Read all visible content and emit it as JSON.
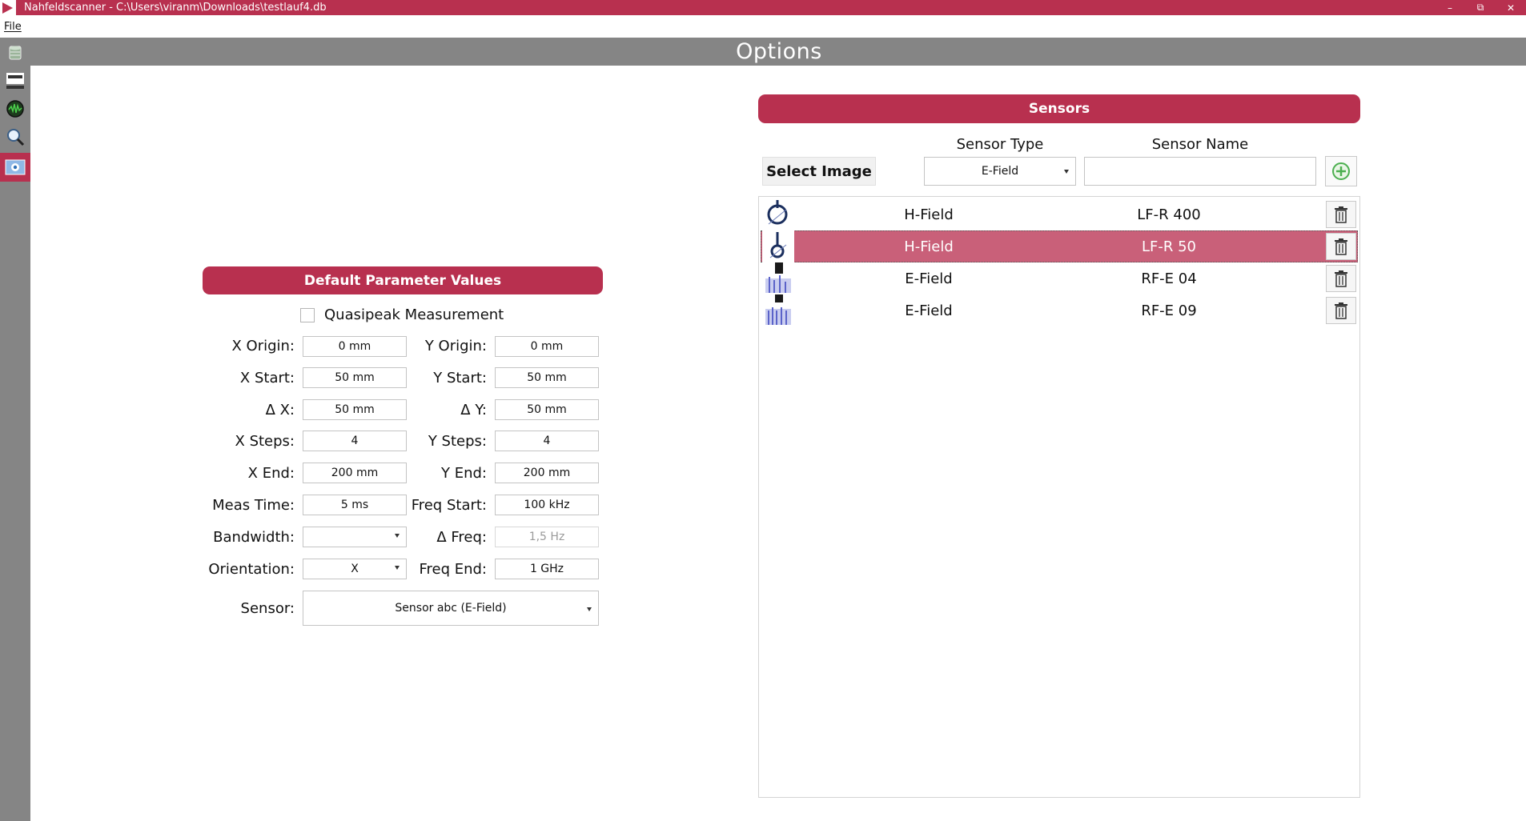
{
  "window": {
    "title": "Nahfeldscanner - C:\\Users\\viranm\\Downloads\\testlauf4.db",
    "minimize": "–",
    "restore": "⧉",
    "close": "✕"
  },
  "menu": {
    "file": "File"
  },
  "header": {
    "title": "Options"
  },
  "sidebar": {
    "items": [
      {
        "icon": "database-icon"
      },
      {
        "icon": "scanner-icon"
      },
      {
        "icon": "spectrum-icon"
      },
      {
        "icon": "search-icon"
      },
      {
        "icon": "settings-icon",
        "active": true
      }
    ]
  },
  "defaults": {
    "title": "Default Parameter Values",
    "quasipeak_label": "Quasipeak Measurement",
    "quasipeak_checked": false,
    "x_origin_label": "X Origin:",
    "x_origin": "0 mm",
    "y_origin_label": "Y Origin:",
    "y_origin": "0 mm",
    "x_start_label": "X Start:",
    "x_start": "50 mm",
    "y_start_label": "Y Start:",
    "y_start": "50 mm",
    "dx_label": "Δ X:",
    "dx": "50 mm",
    "dy_label": "Δ Y:",
    "dy": "50 mm",
    "x_steps_label": "X Steps:",
    "x_steps": "4",
    "y_steps_label": "Y Steps:",
    "y_steps": "4",
    "x_end_label": "X End:",
    "x_end": "200 mm",
    "y_end_label": "Y End:",
    "y_end": "200 mm",
    "meas_time_label": "Meas Time:",
    "meas_time": "5 ms",
    "freq_start_label": "Freq Start:",
    "freq_start": "100 kHz",
    "bandwidth_label": "Bandwidth:",
    "bandwidth": "",
    "dfreq_label": "Δ Freq:",
    "dfreq": "1,5 Hz",
    "orientation_label": "Orientation:",
    "orientation": "X",
    "freq_end_label": "Freq End:",
    "freq_end": "1 GHz",
    "sensor_label": "Sensor:",
    "sensor": "Sensor abc  (E-Field)"
  },
  "sensors": {
    "title": "Sensors",
    "sensor_type_header": "Sensor Type",
    "sensor_name_header": "Sensor Name",
    "select_image": "Select Image",
    "type_value": "E-Field",
    "name_value": "",
    "rows": [
      {
        "type": "H-Field",
        "name": "LF-R 400"
      },
      {
        "type": "H-Field",
        "name": "LF-R 50",
        "selected": true
      },
      {
        "type": "E-Field",
        "name": "RF-E 04"
      },
      {
        "type": "E-Field",
        "name": "RF-E 09"
      }
    ]
  },
  "colors": {
    "accent": "#b8304f",
    "selected_row": "#c96079",
    "sidebar": "#858585",
    "add_green": "#4caf50"
  }
}
